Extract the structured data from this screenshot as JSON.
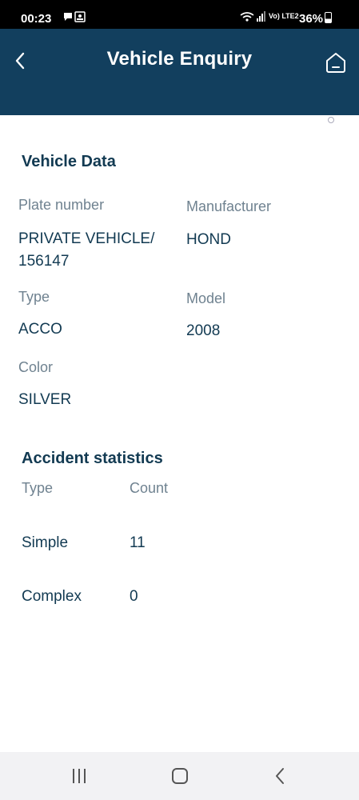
{
  "status_bar": {
    "time": "00:23",
    "battery": "36%",
    "lte": "Vo) LTE2"
  },
  "header": {
    "title": "Vehicle Enquiry",
    "background": "#123f5e"
  },
  "vehicle_data": {
    "title": "Vehicle Data",
    "plate_number_label": "Plate number",
    "plate_number_value_line1": "PRIVATE VEHICLE/",
    "plate_number_value_line2": "156147",
    "manufacturer_label": "Manufacturer",
    "manufacturer_value": "HOND",
    "type_label": "Type",
    "type_value": "ACCO",
    "model_label": "Model",
    "model_value": "2008",
    "color_label": "Color",
    "color_value": "SILVER"
  },
  "accident_statistics": {
    "title": "Accident statistics",
    "columns": [
      "Type",
      "Count"
    ],
    "rows": [
      {
        "type": "Simple",
        "count": "11"
      },
      {
        "type": "Complex",
        "count": "0"
      }
    ]
  },
  "icons": {
    "back": "chevron-left-icon",
    "home": "home-icon",
    "nav_recents": "recents-icon",
    "nav_home": "home-button-icon",
    "nav_back": "back-icon"
  }
}
